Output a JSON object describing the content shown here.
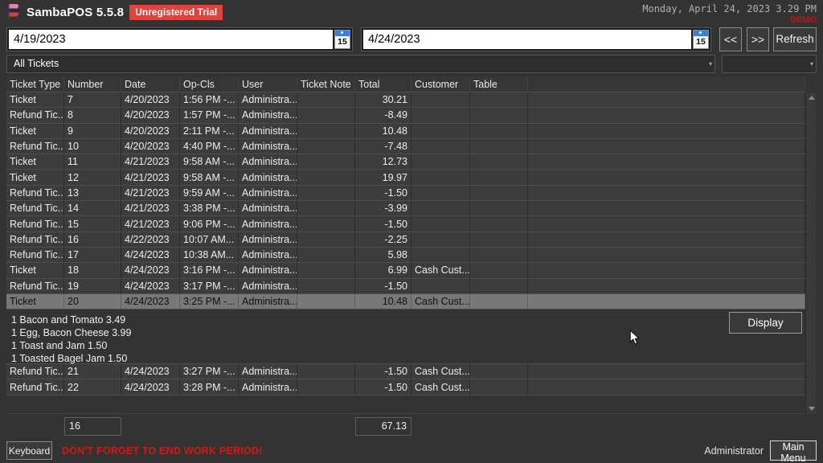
{
  "app": {
    "title": "SambaPOS 5.5.8",
    "license_badge": "Unregistered Trial",
    "datetime": "Monday, April 24, 2023 3.29 PM",
    "demo_label": "DEMO"
  },
  "toolbar": {
    "start_date": "4/19/2023",
    "end_date": "4/24/2023",
    "calendar_day": "15",
    "prev_label": "<<",
    "next_label": ">>",
    "refresh_label": "Refresh"
  },
  "filters": {
    "ticket_filter": "All Tickets",
    "secondary_filter": ""
  },
  "table": {
    "columns": [
      "Ticket Type",
      "Number",
      "Date",
      "Op-Cls",
      "User",
      "Ticket Note",
      "Total",
      "Customer",
      "Table"
    ],
    "rows": [
      {
        "type": "Ticket",
        "number": "7",
        "date": "4/20/2023",
        "opcls": "1:56 PM -...",
        "user": "Administra...",
        "note": "",
        "total": "30.21",
        "customer": "",
        "table": ""
      },
      {
        "type": "Refund Tic...",
        "number": "8",
        "date": "4/20/2023",
        "opcls": "1:57 PM -...",
        "user": "Administra...",
        "note": "",
        "total": "-8.49",
        "customer": "",
        "table": ""
      },
      {
        "type": "Ticket",
        "number": "9",
        "date": "4/20/2023",
        "opcls": "2:11 PM -...",
        "user": "Administra...",
        "note": "",
        "total": "10.48",
        "customer": "",
        "table": ""
      },
      {
        "type": "Refund Tic...",
        "number": "10",
        "date": "4/20/2023",
        "opcls": "4:40 PM -...",
        "user": "Administra...",
        "note": "",
        "total": "-7.48",
        "customer": "",
        "table": ""
      },
      {
        "type": "Ticket",
        "number": "11",
        "date": "4/21/2023",
        "opcls": "9:58 AM -...",
        "user": "Administra...",
        "note": "",
        "total": "12.73",
        "customer": "",
        "table": ""
      },
      {
        "type": "Ticket",
        "number": "12",
        "date": "4/21/2023",
        "opcls": "9:58 AM -...",
        "user": "Administra...",
        "note": "",
        "total": "19.97",
        "customer": "",
        "table": ""
      },
      {
        "type": "Refund Tic...",
        "number": "13",
        "date": "4/21/2023",
        "opcls": "9:59 AM -...",
        "user": "Administra...",
        "note": "",
        "total": "-1.50",
        "customer": "",
        "table": ""
      },
      {
        "type": "Refund Tic...",
        "number": "14",
        "date": "4/21/2023",
        "opcls": "3:38 PM -...",
        "user": "Administra...",
        "note": "",
        "total": "-3.99",
        "customer": "",
        "table": ""
      },
      {
        "type": "Refund Tic...",
        "number": "15",
        "date": "4/21/2023",
        "opcls": "9:06 PM -...",
        "user": "Administra...",
        "note": "",
        "total": "-1.50",
        "customer": "",
        "table": ""
      },
      {
        "type": "Refund Tic...",
        "number": "16",
        "date": "4/22/2023",
        "opcls": "10:07 AM...",
        "user": "Administra...",
        "note": "",
        "total": "-2.25",
        "customer": "",
        "table": ""
      },
      {
        "type": "Refund Tic...",
        "number": "17",
        "date": "4/24/2023",
        "opcls": "10:38 AM...",
        "user": "Administra...",
        "note": "",
        "total": "5.98",
        "customer": "",
        "table": ""
      },
      {
        "type": "Ticket",
        "number": "18",
        "date": "4/24/2023",
        "opcls": "3:16 PM -...",
        "user": "Administra...",
        "note": "",
        "total": "6.99",
        "customer": "Cash Cust...",
        "table": ""
      },
      {
        "type": "Refund Tic...",
        "number": "19",
        "date": "4/24/2023",
        "opcls": "3:17 PM -...",
        "user": "Administra...",
        "note": "",
        "total": "-1.50",
        "customer": "",
        "table": ""
      },
      {
        "type": "Ticket",
        "number": "20",
        "date": "4/24/2023",
        "opcls": "3:25 PM -...",
        "user": "Administra...",
        "note": "",
        "total": "10.48",
        "customer": "Cash Cust...",
        "table": "",
        "selected": true
      },
      {
        "type": "Refund Tic...",
        "number": "21",
        "date": "4/24/2023",
        "opcls": "3:27 PM -...",
        "user": "Administra...",
        "note": "",
        "total": "-1.50",
        "customer": "Cash Cust...",
        "table": ""
      },
      {
        "type": "Refund Tic...",
        "number": "22",
        "date": "4/24/2023",
        "opcls": "3:28 PM -...",
        "user": "Administra...",
        "note": "",
        "total": "-1.50",
        "customer": "Cash Cust...",
        "table": ""
      }
    ],
    "detail": {
      "lines": [
        "1 Bacon and Tomato 3.49",
        "1 Egg, Bacon Cheese 3.99",
        "1 Toast and Jam 1.50",
        "1 Toasted Bagel Jam 1.50"
      ],
      "display_button": "Display"
    },
    "footer": {
      "count": "16",
      "total": "67.13"
    }
  },
  "bottom_bar": {
    "keyboard_label": "Keyboard",
    "warning": "DON'T FORGET TO END WORK PERIOD!",
    "user": "Administrator",
    "main_menu_label": "Main Menu"
  },
  "colors": {
    "background": "#333333",
    "accent_red": "#e0433e",
    "warning_red": "#d11919",
    "selected_row": "#787878",
    "calendar_blue": "#3d7edb"
  }
}
